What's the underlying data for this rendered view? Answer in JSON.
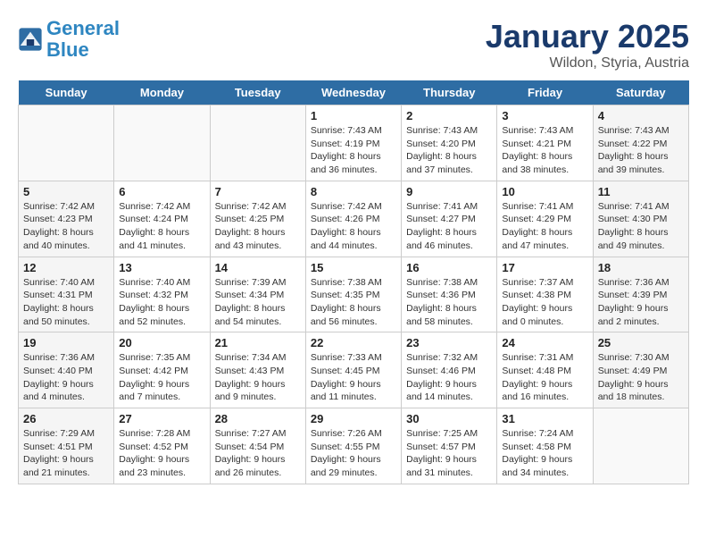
{
  "header": {
    "logo_line1": "General",
    "logo_line2": "Blue",
    "month": "January 2025",
    "location": "Wildon, Styria, Austria"
  },
  "days_of_week": [
    "Sunday",
    "Monday",
    "Tuesday",
    "Wednesday",
    "Thursday",
    "Friday",
    "Saturday"
  ],
  "weeks": [
    [
      {
        "day": "",
        "info": ""
      },
      {
        "day": "",
        "info": ""
      },
      {
        "day": "",
        "info": ""
      },
      {
        "day": "1",
        "info": "Sunrise: 7:43 AM\nSunset: 4:19 PM\nDaylight: 8 hours and 36 minutes."
      },
      {
        "day": "2",
        "info": "Sunrise: 7:43 AM\nSunset: 4:20 PM\nDaylight: 8 hours and 37 minutes."
      },
      {
        "day": "3",
        "info": "Sunrise: 7:43 AM\nSunset: 4:21 PM\nDaylight: 8 hours and 38 minutes."
      },
      {
        "day": "4",
        "info": "Sunrise: 7:43 AM\nSunset: 4:22 PM\nDaylight: 8 hours and 39 minutes."
      }
    ],
    [
      {
        "day": "5",
        "info": "Sunrise: 7:42 AM\nSunset: 4:23 PM\nDaylight: 8 hours and 40 minutes."
      },
      {
        "day": "6",
        "info": "Sunrise: 7:42 AM\nSunset: 4:24 PM\nDaylight: 8 hours and 41 minutes."
      },
      {
        "day": "7",
        "info": "Sunrise: 7:42 AM\nSunset: 4:25 PM\nDaylight: 8 hours and 43 minutes."
      },
      {
        "day": "8",
        "info": "Sunrise: 7:42 AM\nSunset: 4:26 PM\nDaylight: 8 hours and 44 minutes."
      },
      {
        "day": "9",
        "info": "Sunrise: 7:41 AM\nSunset: 4:27 PM\nDaylight: 8 hours and 46 minutes."
      },
      {
        "day": "10",
        "info": "Sunrise: 7:41 AM\nSunset: 4:29 PM\nDaylight: 8 hours and 47 minutes."
      },
      {
        "day": "11",
        "info": "Sunrise: 7:41 AM\nSunset: 4:30 PM\nDaylight: 8 hours and 49 minutes."
      }
    ],
    [
      {
        "day": "12",
        "info": "Sunrise: 7:40 AM\nSunset: 4:31 PM\nDaylight: 8 hours and 50 minutes."
      },
      {
        "day": "13",
        "info": "Sunrise: 7:40 AM\nSunset: 4:32 PM\nDaylight: 8 hours and 52 minutes."
      },
      {
        "day": "14",
        "info": "Sunrise: 7:39 AM\nSunset: 4:34 PM\nDaylight: 8 hours and 54 minutes."
      },
      {
        "day": "15",
        "info": "Sunrise: 7:38 AM\nSunset: 4:35 PM\nDaylight: 8 hours and 56 minutes."
      },
      {
        "day": "16",
        "info": "Sunrise: 7:38 AM\nSunset: 4:36 PM\nDaylight: 8 hours and 58 minutes."
      },
      {
        "day": "17",
        "info": "Sunrise: 7:37 AM\nSunset: 4:38 PM\nDaylight: 9 hours and 0 minutes."
      },
      {
        "day": "18",
        "info": "Sunrise: 7:36 AM\nSunset: 4:39 PM\nDaylight: 9 hours and 2 minutes."
      }
    ],
    [
      {
        "day": "19",
        "info": "Sunrise: 7:36 AM\nSunset: 4:40 PM\nDaylight: 9 hours and 4 minutes."
      },
      {
        "day": "20",
        "info": "Sunrise: 7:35 AM\nSunset: 4:42 PM\nDaylight: 9 hours and 7 minutes."
      },
      {
        "day": "21",
        "info": "Sunrise: 7:34 AM\nSunset: 4:43 PM\nDaylight: 9 hours and 9 minutes."
      },
      {
        "day": "22",
        "info": "Sunrise: 7:33 AM\nSunset: 4:45 PM\nDaylight: 9 hours and 11 minutes."
      },
      {
        "day": "23",
        "info": "Sunrise: 7:32 AM\nSunset: 4:46 PM\nDaylight: 9 hours and 14 minutes."
      },
      {
        "day": "24",
        "info": "Sunrise: 7:31 AM\nSunset: 4:48 PM\nDaylight: 9 hours and 16 minutes."
      },
      {
        "day": "25",
        "info": "Sunrise: 7:30 AM\nSunset: 4:49 PM\nDaylight: 9 hours and 18 minutes."
      }
    ],
    [
      {
        "day": "26",
        "info": "Sunrise: 7:29 AM\nSunset: 4:51 PM\nDaylight: 9 hours and 21 minutes."
      },
      {
        "day": "27",
        "info": "Sunrise: 7:28 AM\nSunset: 4:52 PM\nDaylight: 9 hours and 23 minutes."
      },
      {
        "day": "28",
        "info": "Sunrise: 7:27 AM\nSunset: 4:54 PM\nDaylight: 9 hours and 26 minutes."
      },
      {
        "day": "29",
        "info": "Sunrise: 7:26 AM\nSunset: 4:55 PM\nDaylight: 9 hours and 29 minutes."
      },
      {
        "day": "30",
        "info": "Sunrise: 7:25 AM\nSunset: 4:57 PM\nDaylight: 9 hours and 31 minutes."
      },
      {
        "day": "31",
        "info": "Sunrise: 7:24 AM\nSunset: 4:58 PM\nDaylight: 9 hours and 34 minutes."
      },
      {
        "day": "",
        "info": ""
      }
    ]
  ]
}
